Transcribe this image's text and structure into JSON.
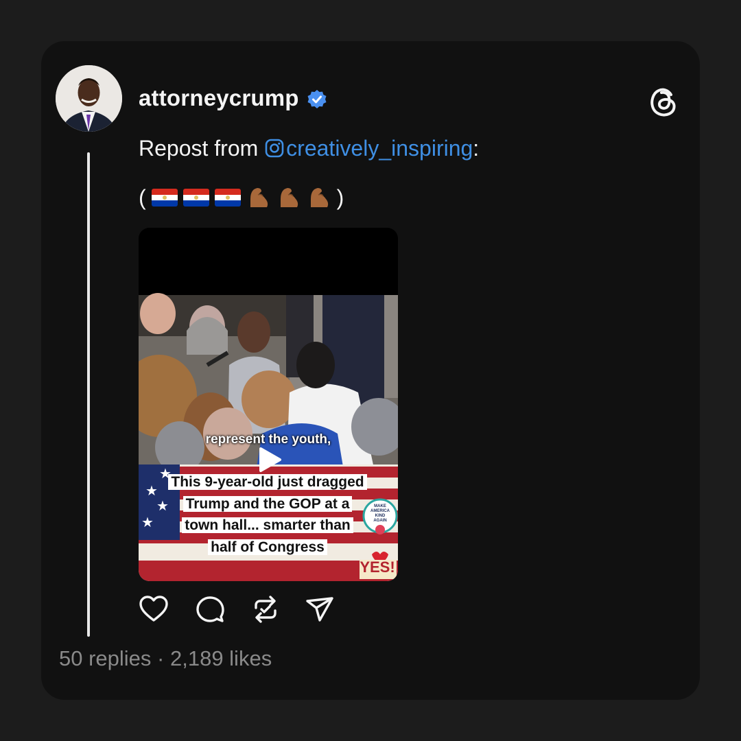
{
  "post": {
    "username": "attorneycrump",
    "verified": true,
    "repost_prefix": "Repost from ",
    "repost_handle": "creatively_inspiring",
    "repost_suffix": ":",
    "emoji_open": "(",
    "emoji_close": ")",
    "emoji_icons": [
      "paraguay-flag-icon",
      "paraguay-flag-icon",
      "paraguay-flag-icon",
      "flexed-biceps-icon",
      "flexed-biceps-icon",
      "flexed-biceps-icon"
    ],
    "video": {
      "caption_line1": "represent the youth,",
      "headline_lines": [
        "This 9-year-old just dragged",
        "Trump and the GOP at a",
        "town hall... smarter than",
        "half of Congress"
      ],
      "badge_text": "MAKE AMERICA KIND AGAIN",
      "yes_label": "YES!"
    },
    "replies": "50 replies",
    "separator": " · ",
    "likes": "2,189 likes"
  },
  "colors": {
    "background": "#1c1c1c",
    "card": "#111111",
    "link": "#3f8fe4",
    "verified": "#4a90f0",
    "muted": "#8a8a8a"
  },
  "icons": {
    "brand": "threads-logo-icon",
    "actions": [
      "heart-icon",
      "comment-icon",
      "repost-icon",
      "share-icon"
    ]
  }
}
